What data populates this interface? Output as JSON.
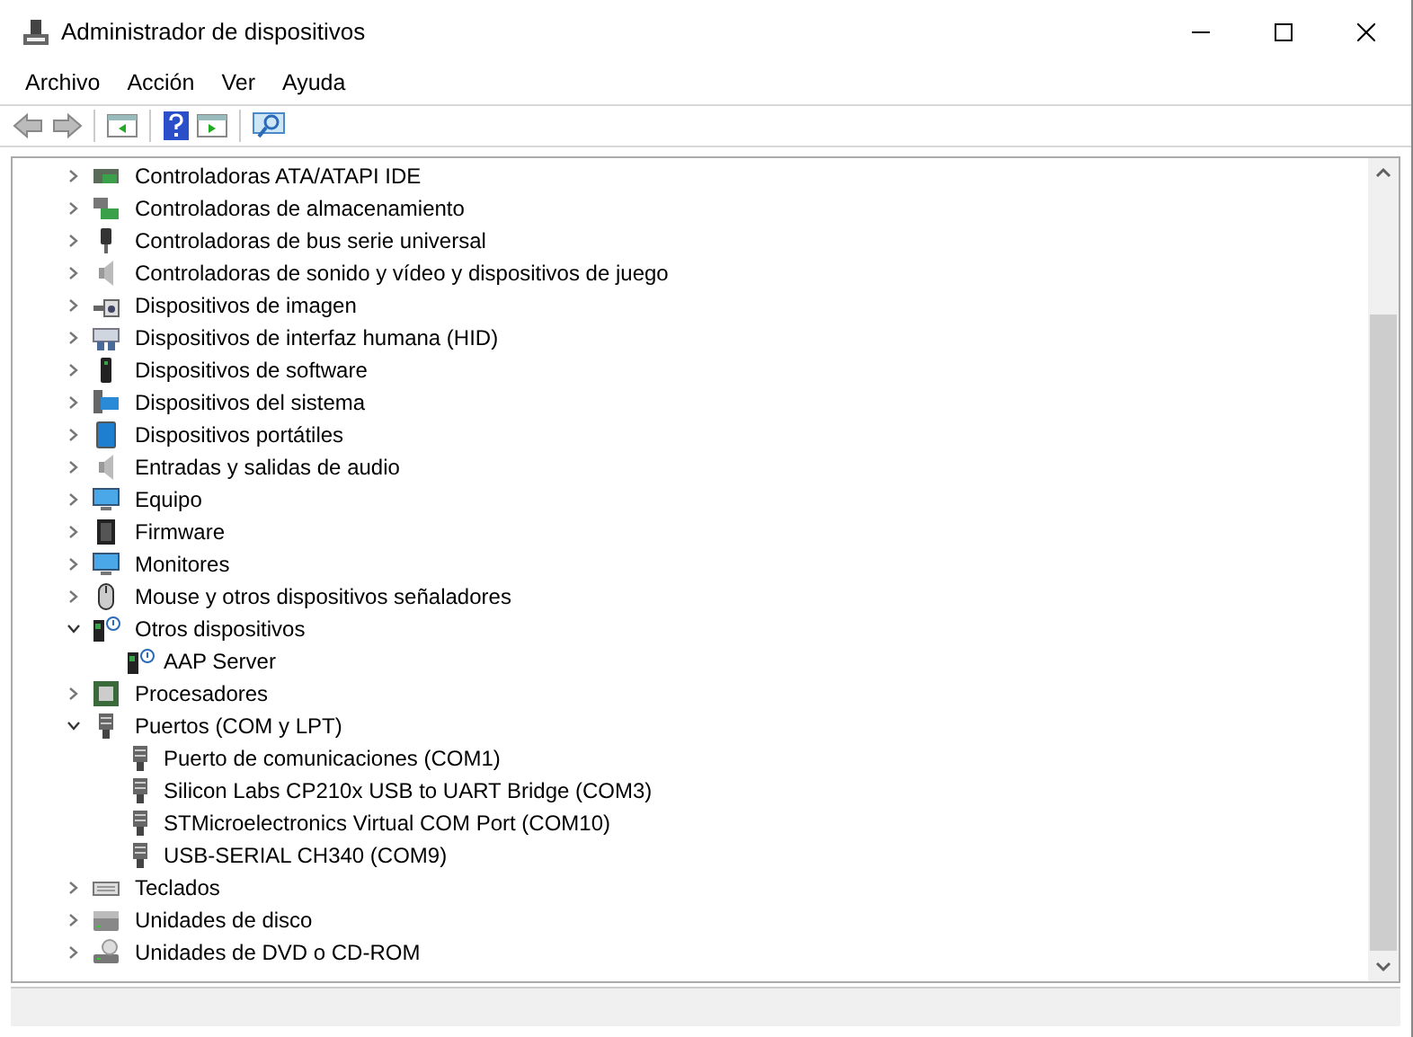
{
  "window": {
    "title": "Administrador de dispositivos"
  },
  "menu": [
    "Archivo",
    "Acción",
    "Ver",
    "Ayuda"
  ],
  "tree": [
    {
      "label": "Controladoras ATA/ATAPI IDE",
      "expanded": false
    },
    {
      "label": "Controladoras de almacenamiento",
      "expanded": false
    },
    {
      "label": "Controladoras de bus serie universal",
      "expanded": false
    },
    {
      "label": "Controladoras de sonido y vídeo y dispositivos de juego",
      "expanded": false
    },
    {
      "label": "Dispositivos de imagen",
      "expanded": false
    },
    {
      "label": "Dispositivos de interfaz humana (HID)",
      "expanded": false
    },
    {
      "label": "Dispositivos de software",
      "expanded": false
    },
    {
      "label": "Dispositivos del sistema",
      "expanded": false
    },
    {
      "label": "Dispositivos portátiles",
      "expanded": false
    },
    {
      "label": "Entradas y salidas de audio",
      "expanded": false
    },
    {
      "label": "Equipo",
      "expanded": false
    },
    {
      "label": "Firmware",
      "expanded": false
    },
    {
      "label": "Monitores",
      "expanded": false
    },
    {
      "label": "Mouse y otros dispositivos señaladores",
      "expanded": false
    },
    {
      "label": "Otros dispositivos",
      "expanded": true,
      "children": [
        {
          "label": "AAP Server"
        }
      ]
    },
    {
      "label": "Procesadores",
      "expanded": false
    },
    {
      "label": "Puertos (COM y LPT)",
      "expanded": true,
      "children": [
        {
          "label": "Puerto de comunicaciones (COM1)"
        },
        {
          "label": "Silicon Labs CP210x USB to UART Bridge (COM3)"
        },
        {
          "label": "STMicroelectronics Virtual COM Port (COM10)"
        },
        {
          "label": "USB-SERIAL CH340 (COM9)"
        }
      ]
    },
    {
      "label": "Teclados",
      "expanded": false
    },
    {
      "label": "Unidades de disco",
      "expanded": false
    },
    {
      "label": "Unidades de DVD o CD-ROM",
      "expanded": false
    }
  ]
}
